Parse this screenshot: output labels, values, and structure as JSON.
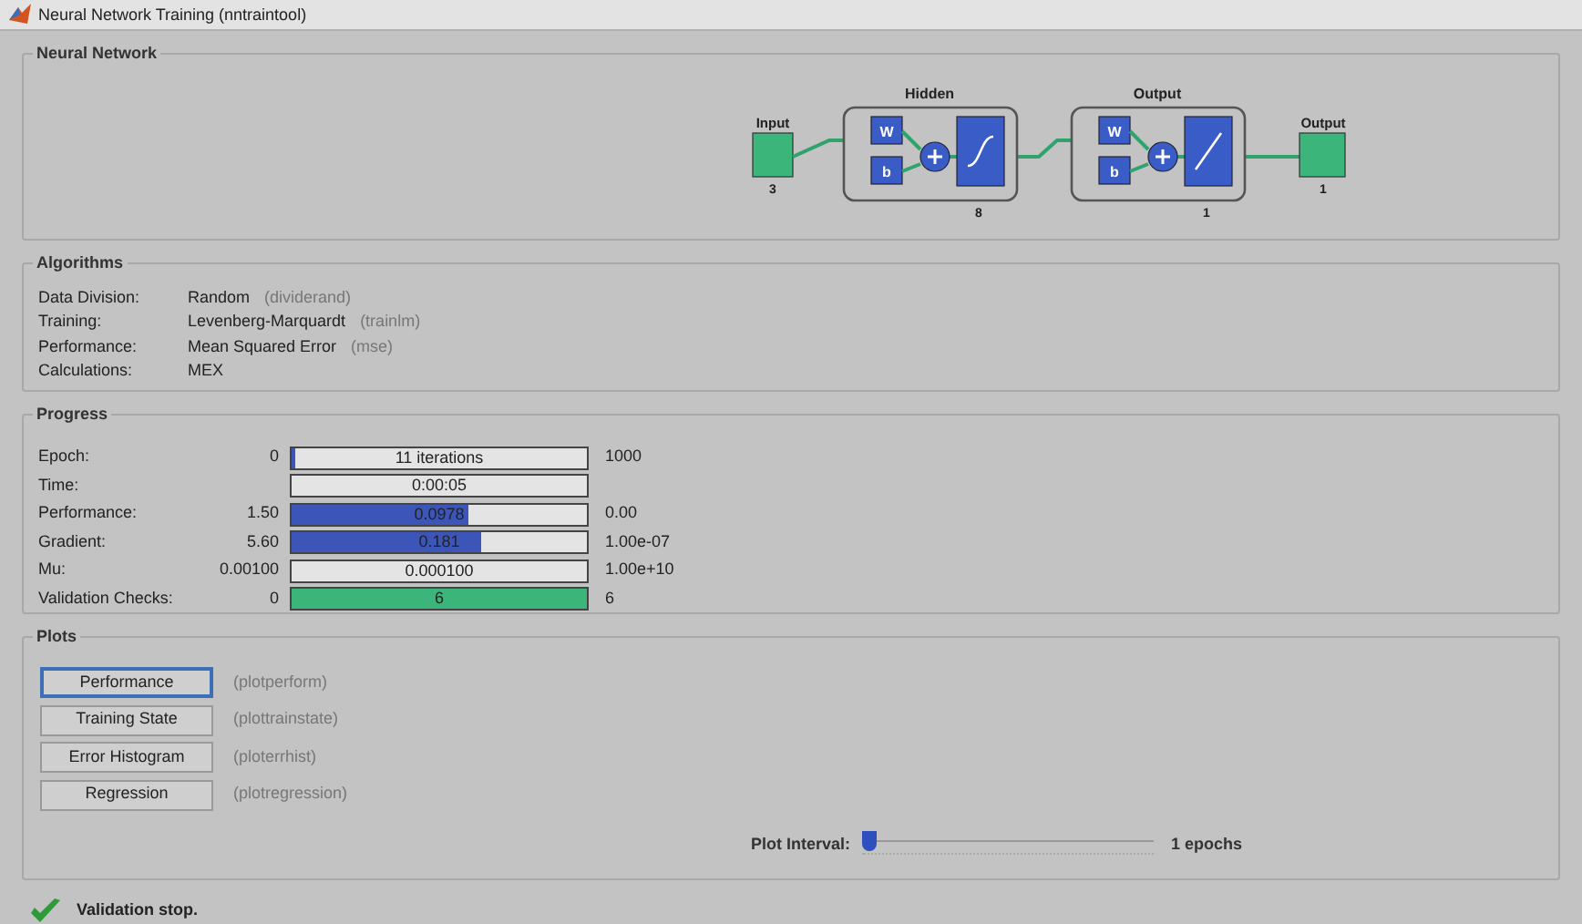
{
  "window": {
    "title": "Neural Network Training (nntraintool)"
  },
  "network": {
    "title": "Neural Network",
    "input": {
      "label": "Input",
      "size": "3"
    },
    "layers": [
      {
        "title": "Hidden",
        "size": "8",
        "weight": "W",
        "bias": "b",
        "kind": "sigmoid"
      },
      {
        "title": "Output",
        "size": "1",
        "weight": "W",
        "bias": "b",
        "kind": "linear"
      }
    ],
    "output": {
      "label": "Output",
      "size": "1"
    }
  },
  "algorithms": {
    "title": "Algorithms",
    "rows": [
      {
        "label": "Data Division:",
        "value": "Random",
        "function": "(dividerand)"
      },
      {
        "label": "Training:",
        "value": "Levenberg-Marquardt",
        "function": "(trainlm)"
      },
      {
        "label": "Performance:",
        "value": "Mean Squared Error",
        "function": "(mse)"
      },
      {
        "label": "Calculations:",
        "value": "MEX"
      }
    ]
  },
  "progress": {
    "title": "Progress",
    "rows": [
      {
        "label": "Epoch:",
        "start": "0",
        "bar_text": "11 iterations",
        "end": "1000",
        "level": 0.01,
        "color": "#3c55b8"
      },
      {
        "label": "Time:",
        "bar_text": "0:00:05",
        "level": 0
      },
      {
        "label": "Performance:",
        "start": "1.50",
        "bar_text": "0.0978",
        "end": "0.00",
        "level": 0.6,
        "color": "#3c55b8"
      },
      {
        "label": "Gradient:",
        "start": "5.60",
        "bar_text": "0.181",
        "end": "1.00e-07",
        "level": 0.64,
        "color": "#3c55b8"
      },
      {
        "label": "Mu:",
        "start": "0.00100",
        "bar_text": "0.000100",
        "end": "1.00e+10",
        "level": 0
      },
      {
        "label": "Validation Checks:",
        "start": "0",
        "bar_text": "6",
        "end": "6",
        "level": 1,
        "color": "#3cb57a"
      }
    ]
  },
  "plots": {
    "title": "Plots",
    "buttons": [
      {
        "label": "Performance",
        "function": "(plotperform)",
        "selected": true
      },
      {
        "label": "Training State",
        "function": "(plottrainstate)",
        "selected": false
      },
      {
        "label": "Error Histogram",
        "function": "(ploterrhist)",
        "selected": false
      },
      {
        "label": "Regression",
        "function": "(plotregression)",
        "selected": false
      }
    ],
    "interval": {
      "label": "Plot Interval:",
      "level": 0,
      "reading": "1 epochs"
    }
  },
  "status": {
    "ok": true,
    "text": "Validation stop."
  }
}
